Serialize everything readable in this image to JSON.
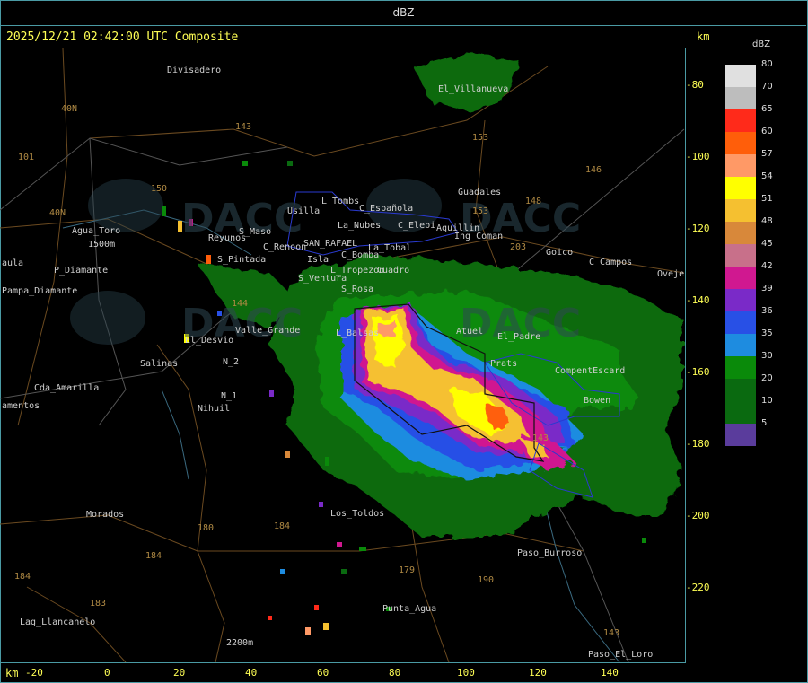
{
  "header": {
    "title": "dBZ"
  },
  "subtitle": "2025/12/21 02:42:00 UTC Composite",
  "units": {
    "top": "km",
    "bottom": "km"
  },
  "legend": {
    "title": "dBZ",
    "items": [
      {
        "label": "80",
        "color": "#e0e0e0"
      },
      {
        "label": "70",
        "color": "#bdbdbd"
      },
      {
        "label": "65",
        "color": "#ff2a1a"
      },
      {
        "label": "60",
        "color": "#ff5e0a"
      },
      {
        "label": "57",
        "color": "#ff9966"
      },
      {
        "label": "54",
        "color": "#ffff00"
      },
      {
        "label": "51",
        "color": "#f5c030"
      },
      {
        "label": "48",
        "color": "#d8883a"
      },
      {
        "label": "45",
        "color": "#c8708a"
      },
      {
        "label": "42",
        "color": "#d01890"
      },
      {
        "label": "39",
        "color": "#7a2ac8"
      },
      {
        "label": "36",
        "color": "#2850e6"
      },
      {
        "label": "35",
        "color": "#1e8ce0"
      },
      {
        "label": "30",
        "color": "#0a8a0a"
      },
      {
        "label": "20",
        "color": "#0a6a10"
      },
      {
        "label": "10",
        "color": "#0a6a10"
      },
      {
        "label": "5",
        "color": "#5a3c9c"
      }
    ]
  },
  "axes": {
    "y_ticks": [
      "-80",
      "-100",
      "-120",
      "-140",
      "-160",
      "-180",
      "-200",
      "-220"
    ],
    "x_ticks": [
      "-20",
      "0",
      "20",
      "40",
      "60",
      "80",
      "100",
      "120",
      "140"
    ]
  },
  "places": {
    "divisadero": "Divisadero",
    "el_villanueva": "El_Villanueva",
    "r153a": "153",
    "r143a": "143",
    "r40n_a": "40N",
    "r101": "101",
    "r150": "150",
    "r40n_b": "40N",
    "r146": "146",
    "guadales": "Guadales",
    "r148": "148",
    "usilla": "Usilla",
    "l_tombs": "L_Tombs",
    "c_espanola": "C_Española",
    "r153b": "153",
    "agua_toro": "Agua_Toro",
    "agua_toro_h": "1500m",
    "la_nubes": "La_Nubes",
    "c_elepi": "C_Elepi",
    "aquillin": "Aquillin",
    "ing_coman": "Ing_Coman",
    "reyunos": "Reyunos",
    "s_maso": "S_Maso",
    "c_renoon": "C_Renoon",
    "san_rafael": "SAN_RAFAEL",
    "la_tobal": "La_Tobal",
    "goico": "Goico",
    "r203": "203",
    "c_campos": "C_Campos",
    "aula": "aula",
    "p_diamante": "P_Diamante",
    "s_pintada": "S_Pintada",
    "isla": "Isla",
    "c_bomba": "C_Bomba",
    "l_tropezon": "L_Tropezon",
    "cuadro": "Cuadro",
    "ovejeria": "Oveje",
    "pampa_diamante": "Pampa_Diamante",
    "s_ventura": "S_Ventura",
    "s_rosa": "S_Rosa",
    "r144": "144",
    "valle_grande": "Valle_Grande",
    "l_balsas": "L_Balsas",
    "atuel": "Atuel",
    "el_desvio": "El_Desvio",
    "el_padre": "El_Padre",
    "n2": "N_2",
    "salinas": "Salinas",
    "prats": "Prats",
    "compent_escard": "CompentEscard",
    "cda_amarilla": "Cda_Amarilla",
    "n1": "N_1",
    "nihuil": "Nihuil",
    "bowen": "Bowen",
    "amentos": "amentos",
    "r143c": "143",
    "morados": "Morados",
    "los_toldos": "Los_Toldos",
    "r180": "180",
    "r184a": "184",
    "paso_burroso": "Paso_Burroso",
    "r184b": "184",
    "r179": "179",
    "r190": "190",
    "r184c": "184",
    "r183": "183",
    "punta_agua": "Punta_Agua",
    "lag_llancanelo": "Lag_Llancanelo",
    "r143d": "143",
    "h2200": "2200m",
    "paso_el_loro": "Paso_El_Loro"
  },
  "watermarks": {
    "a": "DACC",
    "b": "DACC",
    "c": "DACC",
    "d": "DACC"
  }
}
